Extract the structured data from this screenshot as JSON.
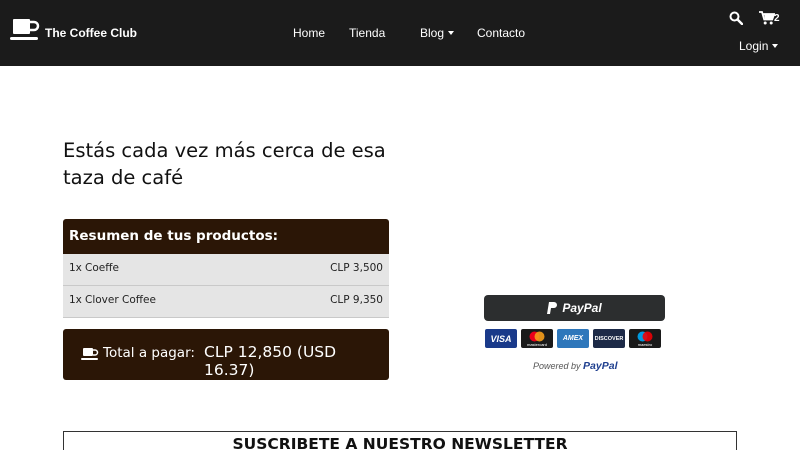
{
  "brand": {
    "name": "The Coffee Club",
    "icon": "coffee-cup-icon"
  },
  "nav": {
    "home": "Home",
    "tienda": "Tienda",
    "blog": "Blog",
    "contacto": "Contacto",
    "cart_count": "2",
    "login": "Login"
  },
  "main": {
    "headline": "Estás cada vez más cerca de esa taza de café",
    "summary": {
      "title": "Resumen de tus productos:",
      "items": [
        {
          "qty": "1x",
          "name": "Coeffe",
          "price": "CLP 3,500"
        },
        {
          "qty": "1x",
          "name": "Clover Coffee",
          "price": "CLP 9,350"
        }
      ]
    },
    "total": {
      "label": "Total a pagar:",
      "value": "CLP 12,850 (USD 16.37)"
    }
  },
  "paypal": {
    "button_label": "PayPal",
    "cards": [
      "VISA",
      "mastercard",
      "AMEX",
      "DISCOVER",
      "maestro"
    ],
    "powered_by": "Powered by",
    "powered_brand": "PayPal"
  },
  "newsletter": {
    "title": "SUSCRIBETE A NUESTRO NEWSLETTER"
  },
  "colors": {
    "navbar": "#1b1b1b",
    "summary_bg": "#2b1606",
    "row_bg": "#e5e5e5"
  }
}
